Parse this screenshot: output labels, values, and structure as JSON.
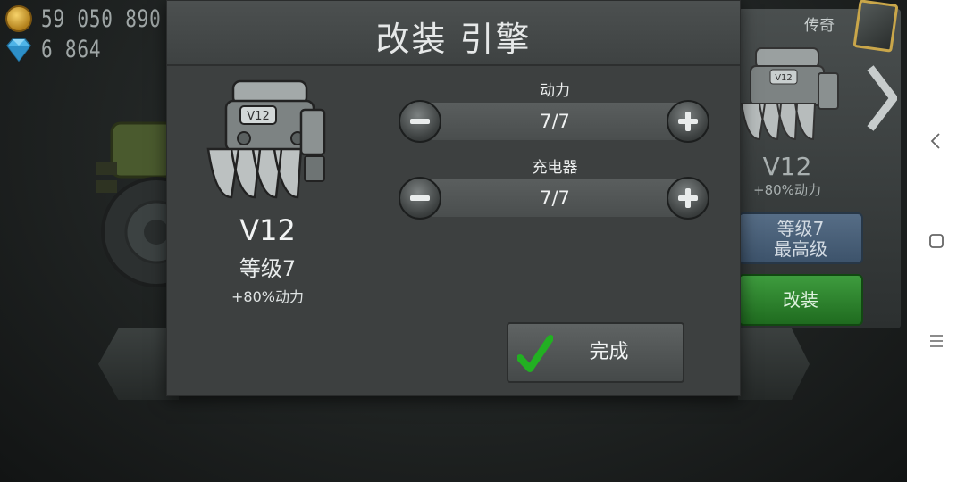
{
  "hud": {
    "coins": "59 050 890",
    "gems": "6 864"
  },
  "modal": {
    "title": "改装 引擎",
    "engine": {
      "name": "V12",
      "level": "等级7",
      "bonus": "+80%动力",
      "badge": "V12"
    },
    "stats": [
      {
        "label": "动力",
        "value": "7/7"
      },
      {
        "label": "充电器",
        "value": "7/7"
      }
    ],
    "done_label": "完成"
  },
  "side_card": {
    "tier": "传奇",
    "engine_badge": "V12",
    "name": "V12",
    "bonus": "+80%动力",
    "level_line1": "等级7",
    "level_line2": "最高级",
    "modify_label": "改装"
  },
  "colors": {
    "modal_bg": "#3d4040",
    "done_check": "#22b022",
    "modify_green": "#3e9c3e",
    "level_blue": "#566d86"
  },
  "icons": {
    "coin": "coin-icon",
    "gem": "gem-icon",
    "minus": "minus-icon",
    "plus": "plus-icon",
    "check": "checkmark-icon",
    "back": "back-chevron-icon",
    "home": "home-square-icon",
    "menu": "menu-lines-icon"
  }
}
